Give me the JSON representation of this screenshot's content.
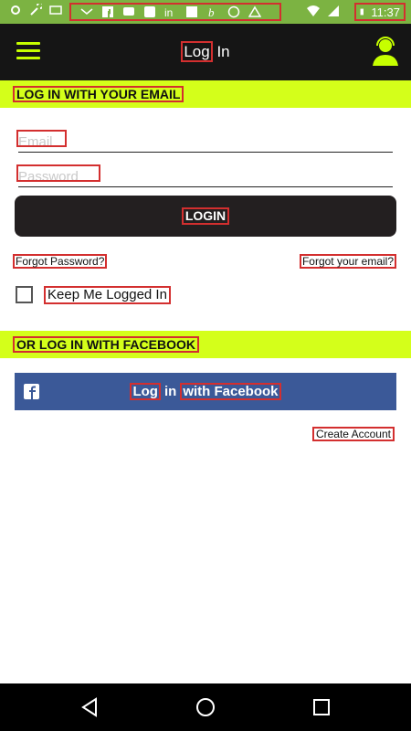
{
  "status_bar": {
    "notification_icons": [
      "settings-icon",
      "mail-icon",
      "facebook-icon",
      "message-icon",
      "phone-icon",
      "linkedin-icon",
      "facebook-icon",
      "hangouts-icon",
      "info-icon",
      "triangle-icon"
    ],
    "right_icons": [
      "wifi-icon",
      "signal-icon",
      "battery-icon"
    ],
    "time": "11:37",
    "color": "#7cb342"
  },
  "app_bar": {
    "title_highlight": "Log",
    "title_rest": "In",
    "accent": "#c6ff00"
  },
  "email_section": {
    "heading": "LOG IN WITH YOUR EMAIL",
    "email_placeholder": "Email",
    "password_placeholder": "Password",
    "login_label": "LOGIN",
    "forgot_password": "Forgot Password?",
    "forgot_email": "Forgot your email?",
    "keep_logged_in": "Keep Me Logged In"
  },
  "facebook_section": {
    "heading": "OR LOG IN WITH FACEBOOK",
    "button_part1": "Log",
    "button_part2": "in",
    "button_part3": "with Facebook",
    "color": "#3b5998"
  },
  "create_account": "Create Account",
  "nav_bar": {
    "icons": [
      "back-icon",
      "home-icon",
      "recents-icon"
    ]
  }
}
